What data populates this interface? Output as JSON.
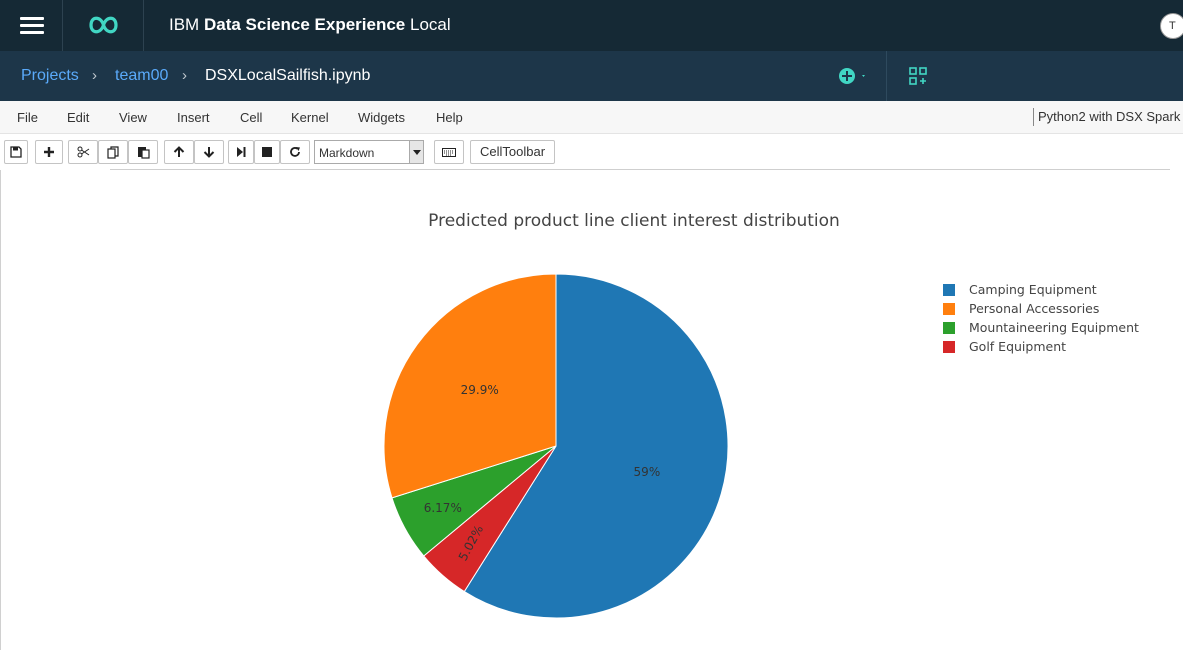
{
  "app": {
    "brand_prefix": "IBM",
    "brand_bold": "Data Science Experience",
    "brand_suffix": "Local",
    "avatar_initial": "T"
  },
  "breadcrumb": [
    "Projects",
    "team00",
    "DSXLocalSailfish.ipynb"
  ],
  "menu": [
    "File",
    "Edit",
    "View",
    "Insert",
    "Cell",
    "Kernel",
    "Widgets",
    "Help"
  ],
  "kernel": "Python2 with DSX Spark",
  "toolbar": {
    "cell_type": "Markdown",
    "celltoolbar_label": "CellToolbar",
    "icons": [
      "save-icon",
      "plus-icon",
      "cut-icon",
      "copy-icon",
      "paste-icon",
      "arrow-up-icon",
      "arrow-down-icon",
      "step-forward-icon",
      "stop-icon",
      "refresh-icon",
      "keyboard-icon"
    ]
  },
  "colors": {
    "topbar": "#152935",
    "navbar": "#1d3649",
    "accent": "#5aaafa",
    "logo_teal": "#41d6c3"
  },
  "chart_data": {
    "type": "pie",
    "title": "Predicted product line client interest distribution",
    "slices": [
      {
        "label": "Camping Equipment",
        "value": 59.0,
        "text": "59%",
        "color": "#1f77b4"
      },
      {
        "label": "Golf Equipment",
        "value": 5.02,
        "text": "5.02%",
        "color": "#d62728"
      },
      {
        "label": "Mountaineering Equipment",
        "value": 6.17,
        "text": "6.17%",
        "color": "#2ca02c"
      },
      {
        "label": "Personal Accessories",
        "value": 29.9,
        "text": "29.9%",
        "color": "#ff7f0e"
      }
    ],
    "legend": [
      {
        "label": "Camping Equipment",
        "color": "#1f77b4"
      },
      {
        "label": "Personal Accessories",
        "color": "#ff7f0e"
      },
      {
        "label": "Mountaineering Equipment",
        "color": "#2ca02c"
      },
      {
        "label": "Golf Equipment",
        "color": "#d62728"
      }
    ],
    "legend_position": "top-right",
    "direction": "clockwise",
    "start": "top"
  }
}
